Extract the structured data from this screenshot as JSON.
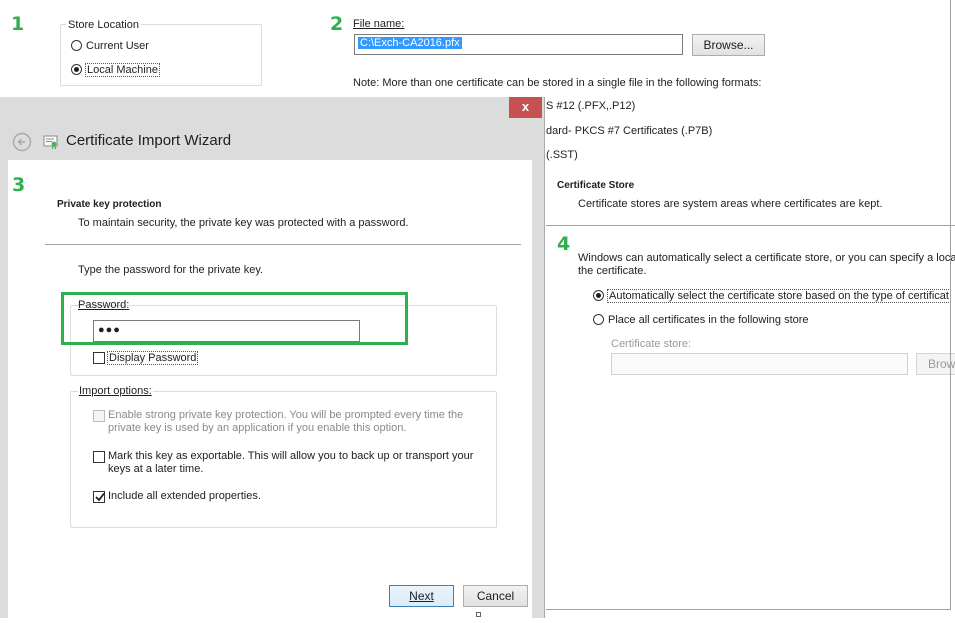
{
  "steps": {
    "s1": "1",
    "s2": "2",
    "s3": "3",
    "s4": "4"
  },
  "store_location": {
    "title": "Store Location",
    "current_user": "Current User",
    "local_machine": "Local Machine",
    "selected": "local_machine"
  },
  "file": {
    "label": "File name:",
    "value": "C:\\Exch-CA2016.pfx",
    "browse": "Browse...",
    "note": "Note:  More than one certificate can be stored in a single file in the following formats:",
    "formats": [
      "S #12 (.PFX,.P12)",
      "dard- PKCS #7 Certificates (.P7B)",
      "(.SST)"
    ]
  },
  "cert_store": {
    "heading": "Certificate Store",
    "desc": "Certificate stores are system areas where certificates are kept.",
    "intro_line1": "Windows can automatically select a certificate store, or you can specify a loca",
    "intro_line2": "the certificate.",
    "auto_option": "Automatically select the certificate store based on the type of certificat",
    "place_option": "Place all certificates in the following store",
    "store_label": "Certificate store:",
    "browse_partial": "Brow"
  },
  "wizard": {
    "close": "x",
    "title": "Certificate Import Wizard",
    "section_title": "Private key protection",
    "section_desc": "To maintain security, the private key was protected with a password.",
    "prompt": "Type the password for the private key.",
    "password_label": "Password:",
    "password_value": "●●●",
    "display_password": "Display Password",
    "import_options": "Import options:",
    "opt_strong_1": "Enable strong private key protection. You will be prompted every time the",
    "opt_strong_2": "private key is used by an application if you enable this option.",
    "opt_export_1": "Mark this key as exportable. This will allow you to back up or transport your",
    "opt_export_2": "keys at a later time.",
    "opt_props": "Include all extended properties.",
    "next": "Next",
    "cancel": "Cancel"
  },
  "colors": {
    "step_green": "#2fb04e",
    "highlight": "#3399ff",
    "close_red": "#c75050"
  }
}
